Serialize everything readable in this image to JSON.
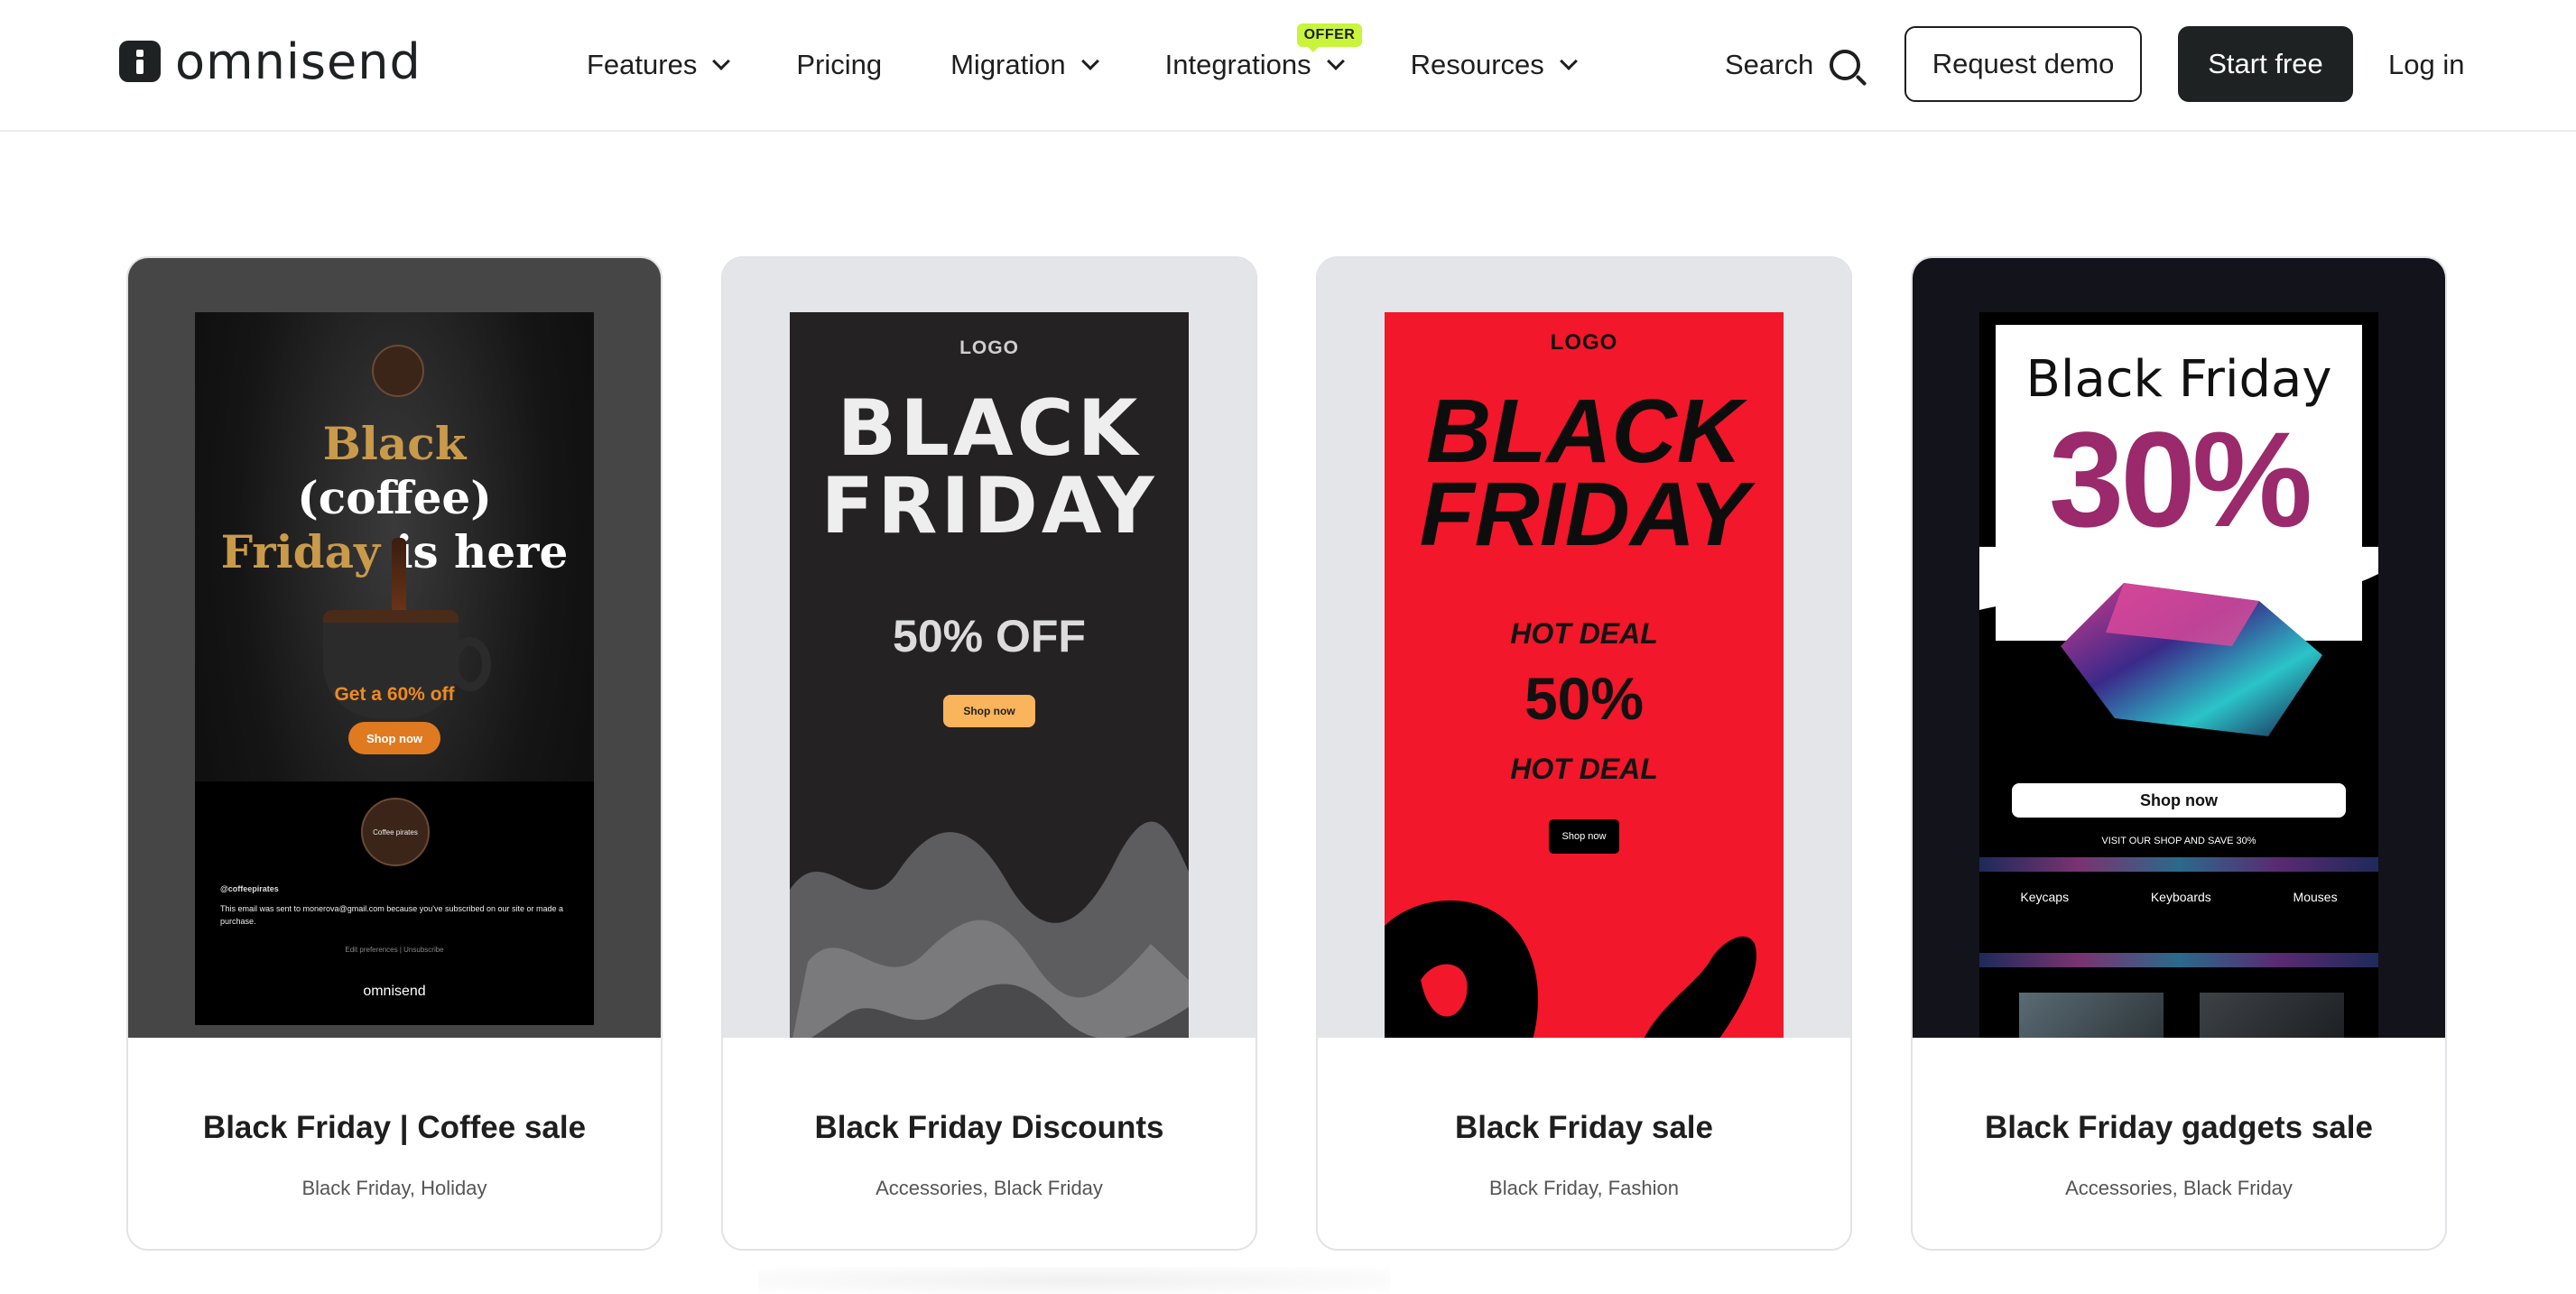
{
  "header": {
    "logo_text": "omnisend",
    "nav": [
      {
        "label": "Features",
        "has_dropdown": true
      },
      {
        "label": "Pricing",
        "has_dropdown": false
      },
      {
        "label": "Migration",
        "has_dropdown": true
      },
      {
        "label": "Integrations",
        "has_dropdown": true,
        "badge": "OFFER"
      },
      {
        "label": "Resources",
        "has_dropdown": true
      }
    ],
    "search_label": "Search",
    "request_demo_label": "Request demo",
    "start_free_label": "Start free",
    "login_label": "Log in"
  },
  "colors": {
    "brand_dark": "#1f2223",
    "offer_badge": "#c9f43c"
  },
  "cards": [
    {
      "title": "Black Friday | Coffee sale",
      "tags": "Black Friday, Holiday",
      "preview": {
        "headline_1": "Black",
        "headline_2": "(coffee)",
        "headline_3a": "Friday",
        "headline_3b": " is here",
        "offer": "Get a 60% off",
        "button": "Shop now",
        "badge_text": "Coffee pirates",
        "handle": "@coffeepirates",
        "note": "This email was sent to monerova@gmail.com because you've subscribed on our site or made a purchase.",
        "prefs": "Edit preferences | Unsubscribe",
        "brand": "omnisend"
      }
    },
    {
      "title": "Black Friday Discounts",
      "tags": "Accessories, Black Friday",
      "preview": {
        "logo": "LOGO",
        "headline_1": "BLACK",
        "headline_2": "FRIDAY",
        "offer": "50% OFF",
        "button": "Shop now"
      }
    },
    {
      "title": "Black Friday sale",
      "tags": "Black Friday, Fashion",
      "preview": {
        "logo": "LOGO",
        "headline_1": "BLACK",
        "headline_2": "FRIDAY",
        "hot_1": "HOT DEAL",
        "percent": "50%",
        "hot_2": "HOT DEAL",
        "button": "Shop now"
      }
    },
    {
      "title": "Black Friday gadgets sale",
      "tags": "Accessories, Black Friday",
      "preview": {
        "headline": "Black Friday",
        "percent": "30%",
        "button": "Shop now",
        "visit": "VISIT OUR SHOP AND SAVE 30%",
        "categories": [
          "Keycaps",
          "Keyboards",
          "Mouses"
        ]
      }
    }
  ]
}
